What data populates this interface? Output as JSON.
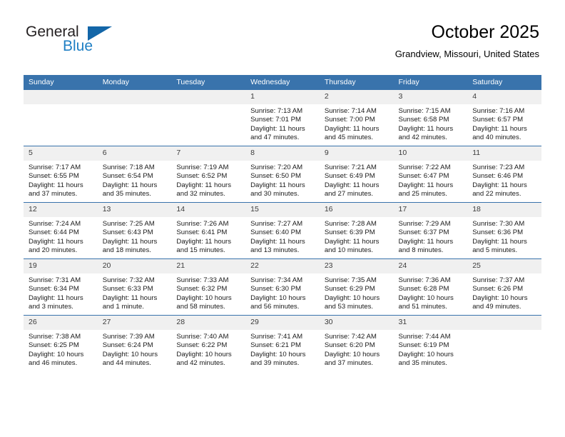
{
  "brand": {
    "name_top": "General",
    "name_bottom": "Blue",
    "accent_color": "#1366a8",
    "text_color": "#231f20"
  },
  "header": {
    "title": "October 2025",
    "subtitle": "Grandview, Missouri, United States"
  },
  "theme": {
    "header_row_bg": "#3973ac",
    "day_label_bg": "#f0f0f0",
    "grid_line": "#3973ac"
  },
  "weekdays": [
    "Sunday",
    "Monday",
    "Tuesday",
    "Wednesday",
    "Thursday",
    "Friday",
    "Saturday"
  ],
  "labels": {
    "sunrise": "Sunrise:",
    "sunset": "Sunset:",
    "daylight": "Daylight:"
  },
  "weeks": [
    [
      {
        "day": "",
        "empty": true
      },
      {
        "day": "",
        "empty": true
      },
      {
        "day": "",
        "empty": true
      },
      {
        "day": "1",
        "sunrise": "Sunrise: 7:13 AM",
        "sunset": "Sunset: 7:01 PM",
        "daylight_1": "Daylight: 11 hours",
        "daylight_2": "and 47 minutes."
      },
      {
        "day": "2",
        "sunrise": "Sunrise: 7:14 AM",
        "sunset": "Sunset: 7:00 PM",
        "daylight_1": "Daylight: 11 hours",
        "daylight_2": "and 45 minutes."
      },
      {
        "day": "3",
        "sunrise": "Sunrise: 7:15 AM",
        "sunset": "Sunset: 6:58 PM",
        "daylight_1": "Daylight: 11 hours",
        "daylight_2": "and 42 minutes."
      },
      {
        "day": "4",
        "sunrise": "Sunrise: 7:16 AM",
        "sunset": "Sunset: 6:57 PM",
        "daylight_1": "Daylight: 11 hours",
        "daylight_2": "and 40 minutes."
      }
    ],
    [
      {
        "day": "5",
        "sunrise": "Sunrise: 7:17 AM",
        "sunset": "Sunset: 6:55 PM",
        "daylight_1": "Daylight: 11 hours",
        "daylight_2": "and 37 minutes."
      },
      {
        "day": "6",
        "sunrise": "Sunrise: 7:18 AM",
        "sunset": "Sunset: 6:54 PM",
        "daylight_1": "Daylight: 11 hours",
        "daylight_2": "and 35 minutes."
      },
      {
        "day": "7",
        "sunrise": "Sunrise: 7:19 AM",
        "sunset": "Sunset: 6:52 PM",
        "daylight_1": "Daylight: 11 hours",
        "daylight_2": "and 32 minutes."
      },
      {
        "day": "8",
        "sunrise": "Sunrise: 7:20 AM",
        "sunset": "Sunset: 6:50 PM",
        "daylight_1": "Daylight: 11 hours",
        "daylight_2": "and 30 minutes."
      },
      {
        "day": "9",
        "sunrise": "Sunrise: 7:21 AM",
        "sunset": "Sunset: 6:49 PM",
        "daylight_1": "Daylight: 11 hours",
        "daylight_2": "and 27 minutes."
      },
      {
        "day": "10",
        "sunrise": "Sunrise: 7:22 AM",
        "sunset": "Sunset: 6:47 PM",
        "daylight_1": "Daylight: 11 hours",
        "daylight_2": "and 25 minutes."
      },
      {
        "day": "11",
        "sunrise": "Sunrise: 7:23 AM",
        "sunset": "Sunset: 6:46 PM",
        "daylight_1": "Daylight: 11 hours",
        "daylight_2": "and 22 minutes."
      }
    ],
    [
      {
        "day": "12",
        "sunrise": "Sunrise: 7:24 AM",
        "sunset": "Sunset: 6:44 PM",
        "daylight_1": "Daylight: 11 hours",
        "daylight_2": "and 20 minutes."
      },
      {
        "day": "13",
        "sunrise": "Sunrise: 7:25 AM",
        "sunset": "Sunset: 6:43 PM",
        "daylight_1": "Daylight: 11 hours",
        "daylight_2": "and 18 minutes."
      },
      {
        "day": "14",
        "sunrise": "Sunrise: 7:26 AM",
        "sunset": "Sunset: 6:41 PM",
        "daylight_1": "Daylight: 11 hours",
        "daylight_2": "and 15 minutes."
      },
      {
        "day": "15",
        "sunrise": "Sunrise: 7:27 AM",
        "sunset": "Sunset: 6:40 PM",
        "daylight_1": "Daylight: 11 hours",
        "daylight_2": "and 13 minutes."
      },
      {
        "day": "16",
        "sunrise": "Sunrise: 7:28 AM",
        "sunset": "Sunset: 6:39 PM",
        "daylight_1": "Daylight: 11 hours",
        "daylight_2": "and 10 minutes."
      },
      {
        "day": "17",
        "sunrise": "Sunrise: 7:29 AM",
        "sunset": "Sunset: 6:37 PM",
        "daylight_1": "Daylight: 11 hours",
        "daylight_2": "and 8 minutes."
      },
      {
        "day": "18",
        "sunrise": "Sunrise: 7:30 AM",
        "sunset": "Sunset: 6:36 PM",
        "daylight_1": "Daylight: 11 hours",
        "daylight_2": "and 5 minutes."
      }
    ],
    [
      {
        "day": "19",
        "sunrise": "Sunrise: 7:31 AM",
        "sunset": "Sunset: 6:34 PM",
        "daylight_1": "Daylight: 11 hours",
        "daylight_2": "and 3 minutes."
      },
      {
        "day": "20",
        "sunrise": "Sunrise: 7:32 AM",
        "sunset": "Sunset: 6:33 PM",
        "daylight_1": "Daylight: 11 hours",
        "daylight_2": "and 1 minute."
      },
      {
        "day": "21",
        "sunrise": "Sunrise: 7:33 AM",
        "sunset": "Sunset: 6:32 PM",
        "daylight_1": "Daylight: 10 hours",
        "daylight_2": "and 58 minutes."
      },
      {
        "day": "22",
        "sunrise": "Sunrise: 7:34 AM",
        "sunset": "Sunset: 6:30 PM",
        "daylight_1": "Daylight: 10 hours",
        "daylight_2": "and 56 minutes."
      },
      {
        "day": "23",
        "sunrise": "Sunrise: 7:35 AM",
        "sunset": "Sunset: 6:29 PM",
        "daylight_1": "Daylight: 10 hours",
        "daylight_2": "and 53 minutes."
      },
      {
        "day": "24",
        "sunrise": "Sunrise: 7:36 AM",
        "sunset": "Sunset: 6:28 PM",
        "daylight_1": "Daylight: 10 hours",
        "daylight_2": "and 51 minutes."
      },
      {
        "day": "25",
        "sunrise": "Sunrise: 7:37 AM",
        "sunset": "Sunset: 6:26 PM",
        "daylight_1": "Daylight: 10 hours",
        "daylight_2": "and 49 minutes."
      }
    ],
    [
      {
        "day": "26",
        "sunrise": "Sunrise: 7:38 AM",
        "sunset": "Sunset: 6:25 PM",
        "daylight_1": "Daylight: 10 hours",
        "daylight_2": "and 46 minutes."
      },
      {
        "day": "27",
        "sunrise": "Sunrise: 7:39 AM",
        "sunset": "Sunset: 6:24 PM",
        "daylight_1": "Daylight: 10 hours",
        "daylight_2": "and 44 minutes."
      },
      {
        "day": "28",
        "sunrise": "Sunrise: 7:40 AM",
        "sunset": "Sunset: 6:22 PM",
        "daylight_1": "Daylight: 10 hours",
        "daylight_2": "and 42 minutes."
      },
      {
        "day": "29",
        "sunrise": "Sunrise: 7:41 AM",
        "sunset": "Sunset: 6:21 PM",
        "daylight_1": "Daylight: 10 hours",
        "daylight_2": "and 39 minutes."
      },
      {
        "day": "30",
        "sunrise": "Sunrise: 7:42 AM",
        "sunset": "Sunset: 6:20 PM",
        "daylight_1": "Daylight: 10 hours",
        "daylight_2": "and 37 minutes."
      },
      {
        "day": "31",
        "sunrise": "Sunrise: 7:44 AM",
        "sunset": "Sunset: 6:19 PM",
        "daylight_1": "Daylight: 10 hours",
        "daylight_2": "and 35 minutes."
      },
      {
        "day": "",
        "empty": true
      }
    ]
  ]
}
